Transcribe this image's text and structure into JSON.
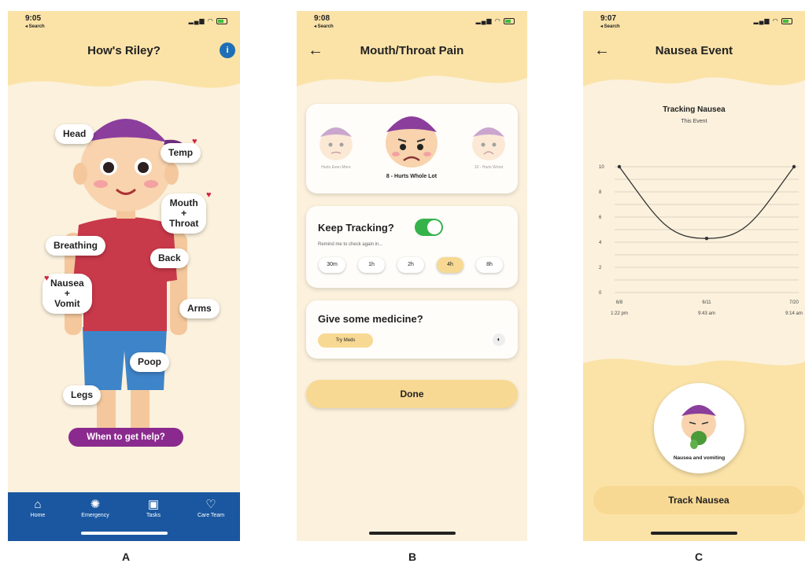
{
  "captions": [
    "A",
    "B",
    "C"
  ],
  "colors": {
    "accent": "#f8d993",
    "header": "#fbe3a8",
    "tabbar": "#1a57a0",
    "purple": "#8b2a8e",
    "toggle_on": "#36b24a"
  },
  "phone_a": {
    "time": "9:05",
    "back_label": "◂ Search",
    "title": "How's Riley?",
    "info_icon": "info-icon",
    "body_parts": {
      "head": "Head",
      "temp": "Temp",
      "mouth_throat": [
        "Mouth",
        "+",
        "Throat"
      ],
      "breathing": "Breathing",
      "back": "Back",
      "nausea_vomit": [
        "Nausea",
        "+",
        "Vomit"
      ],
      "arms": "Arms",
      "poop": "Poop",
      "legs": "Legs"
    },
    "help_button": "When to get help?",
    "tabs": [
      {
        "label": "Home",
        "icon": "home-icon"
      },
      {
        "label": "Emergency",
        "icon": "emergency-icon"
      },
      {
        "label": "Tasks",
        "icon": "clipboard-icon"
      },
      {
        "label": "Care Team",
        "icon": "care-team-icon"
      }
    ]
  },
  "phone_b": {
    "time": "9:08",
    "back_label": "◂ Search",
    "title": "Mouth/Throat Pain",
    "pain_faces": {
      "left_label": "Hurts Even More",
      "main_label": "8 - Hurts Whole Lot",
      "right_label": "10 - Hurts Worst"
    },
    "keep_tracking": {
      "label": "Keep Tracking?",
      "enabled": true,
      "remind_text": "Remind me to check again in...",
      "intervals": [
        "30m",
        "1h",
        "2h",
        "4h",
        "8h"
      ],
      "selected": "4h"
    },
    "medicine": {
      "label": "Give some medicine?",
      "button": "Try Meds"
    },
    "done_button": "Done"
  },
  "phone_c": {
    "time": "9:07",
    "back_label": "◂ Search",
    "title": "Nausea Event",
    "chart_data": {
      "type": "line",
      "title": "Tracking Nausea",
      "subtitle": "This Event",
      "x": [
        "6/8\n1:22 pm",
        "6/11\n9:43 am",
        "7/20\n9:14 am"
      ],
      "x_dates": [
        "6/8",
        "6/11",
        "7/20"
      ],
      "x_times": [
        "1:22 pm",
        "9:43 am",
        "9:14 am"
      ],
      "values": [
        10,
        4.3,
        10
      ],
      "ylim": [
        0,
        10
      ],
      "yticks": [
        0,
        2,
        4,
        6,
        8,
        10
      ],
      "grid": true
    },
    "nausea_label": "Nausea and vomiting",
    "track_button": "Track Nausea"
  }
}
